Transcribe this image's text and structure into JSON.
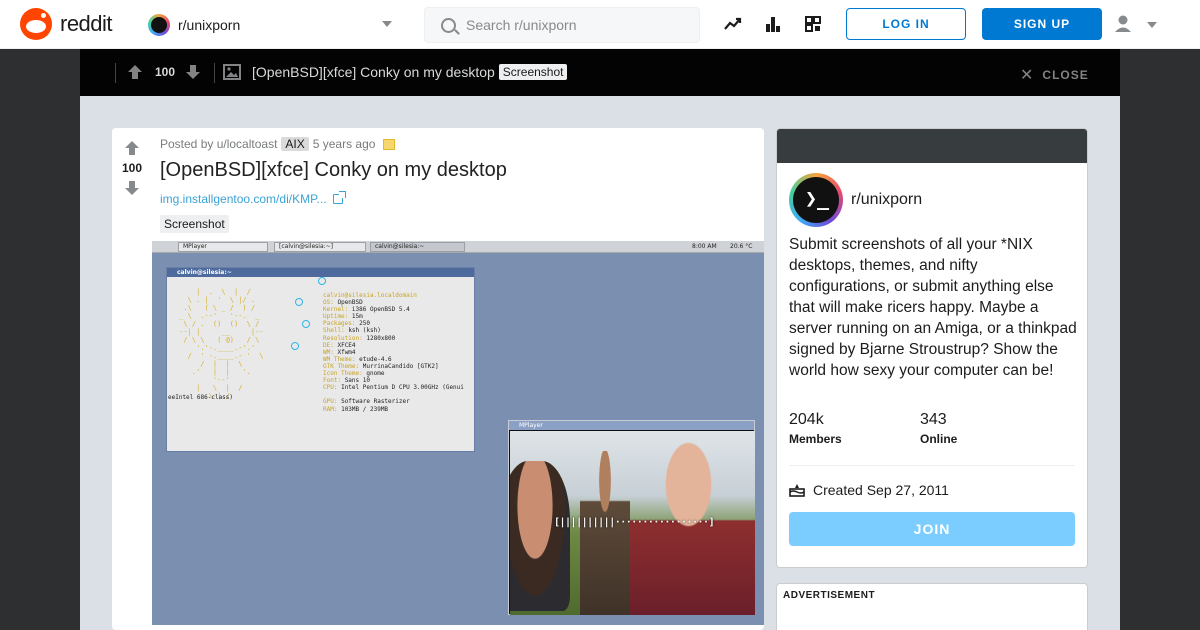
{
  "header": {
    "logo_text": "reddit",
    "community": "r/unixporn",
    "search_placeholder": "Search r/unixporn",
    "login_label": "LOG IN",
    "signup_label": "SIGN UP",
    "icons": [
      "trending-icon",
      "charts-icon",
      "coins-icon",
      "user-icon",
      "chevron-down-icon"
    ]
  },
  "post_bar": {
    "score": "100",
    "title": "[OpenBSD][xfce] Conky on my desktop",
    "flair": "Screenshot",
    "close_label": "CLOSE"
  },
  "post": {
    "score": "100",
    "posted_by": "Posted by u/localtoast",
    "user_flair": "AIX",
    "age": "5 years ago",
    "title": "[OpenBSD][xfce] Conky on my desktop",
    "link_text": "img.installgentoo.com/di/KMP...",
    "flair": "Screenshot"
  },
  "screenshot": {
    "tasks": [
      "MPlayer",
      "[calvin@silesia:~]",
      "calvin@silesia:~"
    ],
    "clock": "8:00 AM",
    "temp": "20.6 °C",
    "terminal_title": "calvin@silesia:~",
    "host": "calvin@silesia.localdomain",
    "info": [
      {
        "k": "OS:",
        "v": "OpenBSD"
      },
      {
        "k": "Kernel:",
        "v": "i386 OpenBSD 5.4"
      },
      {
        "k": "Uptime:",
        "v": "15m"
      },
      {
        "k": "Packages:",
        "v": "250"
      },
      {
        "k": "Shell:",
        "v": "ksh (ksh)"
      },
      {
        "k": "Resolution:",
        "v": "1280x800"
      },
      {
        "k": "DE:",
        "v": "XFCE4"
      },
      {
        "k": "WM:",
        "v": "Xfwm4"
      },
      {
        "k": "WM Theme:",
        "v": "etude-4.6"
      },
      {
        "k": "GTK Theme:",
        "v": "MurrinaCandido [GTK2]"
      },
      {
        "k": "Icon Theme:",
        "v": "gnome"
      },
      {
        "k": "Font:",
        "v": "Sans 10"
      },
      {
        "k": "CPU:",
        "v": "Intel Pentium D CPU 3.00GHz (Genui"
      },
      {
        "k": "",
        "v": ""
      },
      {
        "k": "GPU:",
        "v": "Software Rasterizer"
      },
      {
        "k": "RAM:",
        "v": "103MB / 239MB"
      }
    ],
    "emul_line": "eeIntel 686-class)",
    "mplayer_title": "MPlayer",
    "osd": "[||||||||||·················]"
  },
  "sidebar": {
    "name": "r/unixporn",
    "description": "Submit screenshots of all your *NIX desktops, themes, and nifty configurations, or submit anything else that will make ricers happy. Maybe a server running on an Amiga, or a thinkpad signed by Bjarne Stroustrup? Show the world how sexy your computer can be!",
    "members_value": "204k",
    "members_label": "Members",
    "online_value": "343",
    "online_label": "Online",
    "created": "Created Sep 27, 2011",
    "join_label": "JOIN"
  },
  "ad": {
    "label": "ADVERTISEMENT"
  },
  "colors": {
    "brand": "#ff4500",
    "accent": "#0079d3",
    "join": "#4fbcff"
  }
}
